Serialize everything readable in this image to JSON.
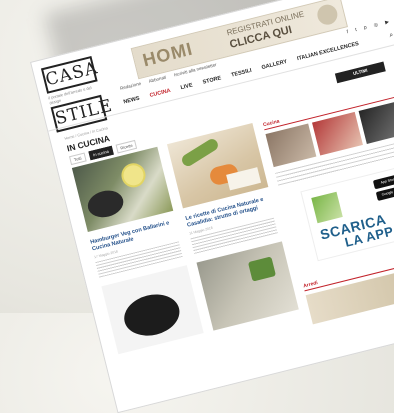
{
  "site": {
    "logo_top": "CASA",
    "logo_tagline": "il portale dell'arredo e del design",
    "logo_bottom": "STILE"
  },
  "banner": {
    "brand": "HOMI",
    "register": "REGISTRATI ONLINE",
    "cta": "CLICCA QUI"
  },
  "toplinks": [
    "Redazione",
    "Abbonati",
    "Iscriviti alla newsletter"
  ],
  "social_icons": [
    "facebook-icon",
    "twitter-icon",
    "pinterest-icon",
    "instagram-icon",
    "youtube-icon"
  ],
  "nav": {
    "items": [
      "NEWS",
      "CUCINA",
      "LIVE",
      "STORE",
      "TESSILI",
      "GALLERY",
      "ITALIAN EXCELLENCES"
    ],
    "active": "CUCINA"
  },
  "breadcrumb": "Home / Cucina / In Cucina",
  "page_title": "IN CUCINA",
  "tabs": [
    "Tutti",
    "In cucina",
    "Ricette"
  ],
  "sort_button": "ULTIMI",
  "cards": [
    {
      "title": "Hamburger Veg con Ballarini e Cucina Naturale",
      "meta": "17 Maggio 2018"
    },
    {
      "title": "Le ricette di Cucina Naturale e Casalidia: strutto di ortaggi",
      "meta": "11 Maggio 2018"
    }
  ],
  "sidebar": {
    "section1": "Cucina",
    "section2": "Arredi"
  },
  "app_ad": {
    "line1": "SCARICA",
    "line2": "LA APP",
    "appstore": "App Store",
    "googleplay": "Google Play"
  }
}
